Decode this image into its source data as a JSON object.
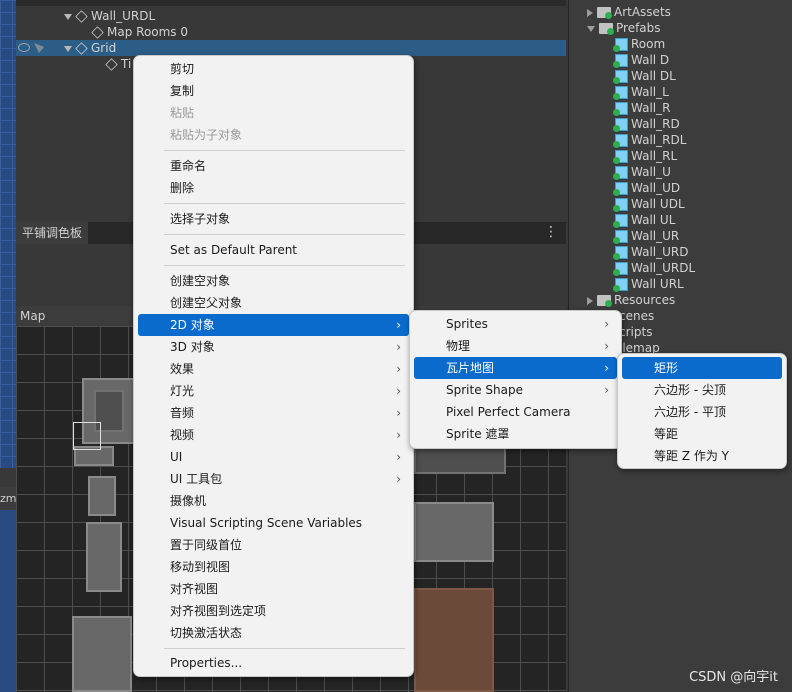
{
  "hierarchy": {
    "rows": [
      {
        "label": "Wall_URDL"
      },
      {
        "label": "Map Rooms 0"
      },
      {
        "label": "Grid"
      },
      {
        "label": "Ti"
      }
    ]
  },
  "palette": {
    "tab_label": "平铺调色板",
    "map_label": "Map"
  },
  "left_tab_label": "zm",
  "project": {
    "rows": [
      {
        "label": "ArtAssets"
      },
      {
        "label": "Prefabs"
      },
      {
        "label": "Room"
      },
      {
        "label": "Wall D"
      },
      {
        "label": "Wall DL"
      },
      {
        "label": "Wall_L"
      },
      {
        "label": "Wall_R"
      },
      {
        "label": "Wall_RD"
      },
      {
        "label": "Wall_RDL"
      },
      {
        "label": "Wall_RL"
      },
      {
        "label": "Wall_U"
      },
      {
        "label": "Wall_UD"
      },
      {
        "label": "Wall UDL"
      },
      {
        "label": "Wall UL"
      },
      {
        "label": "Wall_UR"
      },
      {
        "label": "Wall_URD"
      },
      {
        "label": "Wall_URDL"
      },
      {
        "label": "Wall URL"
      },
      {
        "label": "Resources"
      },
      {
        "label": "cenes"
      },
      {
        "label": "cripts"
      },
      {
        "label": "ilemap"
      }
    ]
  },
  "context_menu": {
    "items": [
      {
        "label": "剪切"
      },
      {
        "label": "复制"
      },
      {
        "label": "粘贴"
      },
      {
        "label": "粘贴为子对象"
      },
      {
        "label": "重命名"
      },
      {
        "label": "删除"
      },
      {
        "label": "选择子对象"
      },
      {
        "label": "Set as Default Parent"
      },
      {
        "label": "创建空对象"
      },
      {
        "label": "创建空父对象"
      },
      {
        "label": "2D 对象"
      },
      {
        "label": "3D 对象"
      },
      {
        "label": "效果"
      },
      {
        "label": "灯光"
      },
      {
        "label": "音频"
      },
      {
        "label": "视频"
      },
      {
        "label": "UI"
      },
      {
        "label": "UI 工具包"
      },
      {
        "label": "摄像机"
      },
      {
        "label": "Visual Scripting Scene Variables"
      },
      {
        "label": "置于同级首位"
      },
      {
        "label": "移动到视图"
      },
      {
        "label": "对齐视图"
      },
      {
        "label": "对齐视图到选定项"
      },
      {
        "label": "切换激活状态"
      },
      {
        "label": "Properties..."
      }
    ]
  },
  "submenu_2d": {
    "items": [
      {
        "label": "Sprites"
      },
      {
        "label": "物理"
      },
      {
        "label": "瓦片地图"
      },
      {
        "label": "Sprite Shape"
      },
      {
        "label": "Pixel Perfect Camera"
      },
      {
        "label": "Sprite 遮罩"
      }
    ]
  },
  "submenu_tilemap": {
    "items": [
      {
        "label": "矩形"
      },
      {
        "label": "六边形 - 尖顶"
      },
      {
        "label": "六边形 - 平顶"
      },
      {
        "label": "等距"
      },
      {
        "label": "等距 Z 作为 Y"
      }
    ]
  },
  "arrow_glyph": "›",
  "watermark": "CSDN @向宇it",
  "colors": {
    "menu_highlight": "#0b6bcc",
    "selection_row": "#2c5d87",
    "menu_bg": "#f2f2f2"
  }
}
